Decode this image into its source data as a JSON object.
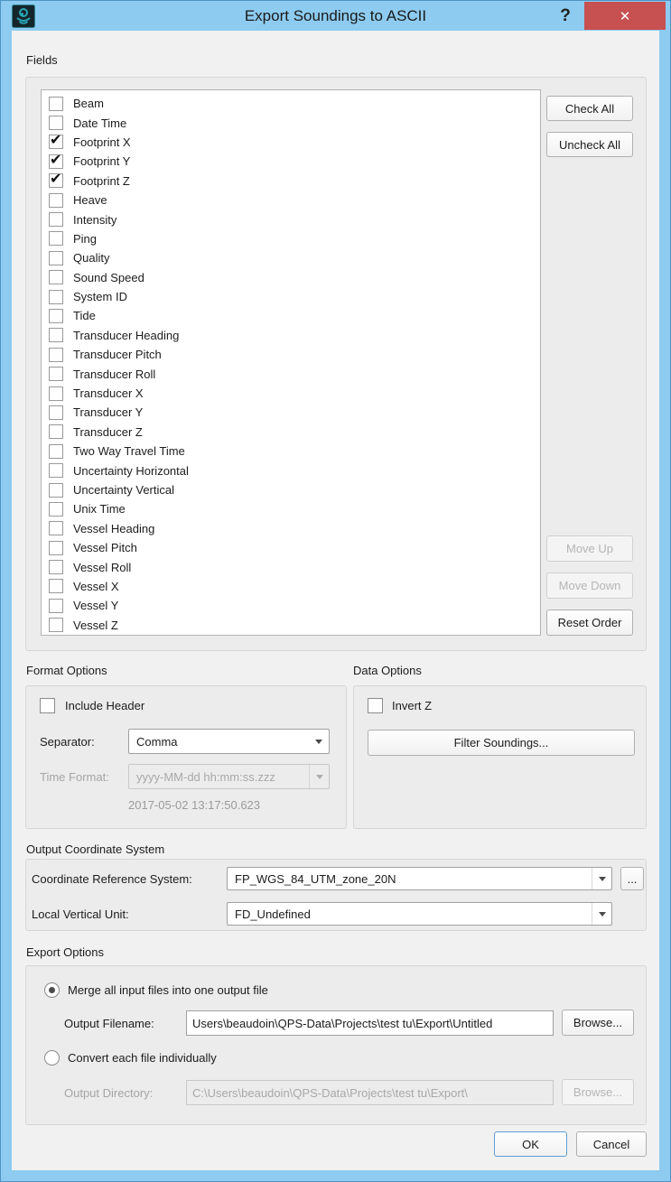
{
  "window": {
    "title": "Export Soundings to ASCII",
    "help_icon": "?",
    "close_icon": "✕"
  },
  "colors": {
    "titlebar": "#8dcbf0",
    "close_button": "#c75050",
    "dialog_bg": "#f1f1f1",
    "groupbox_bg": "#ececec",
    "default_button_border": "#5e9ed9"
  },
  "fields": {
    "section_label": "Fields",
    "check_glyph": "✔",
    "items": [
      {
        "label": "Beam",
        "checked": false
      },
      {
        "label": "Date Time",
        "checked": false
      },
      {
        "label": "Footprint X",
        "checked": true
      },
      {
        "label": "Footprint Y",
        "checked": true
      },
      {
        "label": "Footprint Z",
        "checked": true
      },
      {
        "label": "Heave",
        "checked": false
      },
      {
        "label": "Intensity",
        "checked": false
      },
      {
        "label": "Ping",
        "checked": false
      },
      {
        "label": "Quality",
        "checked": false
      },
      {
        "label": "Sound Speed",
        "checked": false
      },
      {
        "label": "System ID",
        "checked": false
      },
      {
        "label": "Tide",
        "checked": false
      },
      {
        "label": "Transducer Heading",
        "checked": false
      },
      {
        "label": "Transducer Pitch",
        "checked": false
      },
      {
        "label": "Transducer Roll",
        "checked": false
      },
      {
        "label": "Transducer X",
        "checked": false
      },
      {
        "label": "Transducer Y",
        "checked": false
      },
      {
        "label": "Transducer Z",
        "checked": false
      },
      {
        "label": "Two Way Travel Time",
        "checked": false
      },
      {
        "label": "Uncertainty Horizontal",
        "checked": false
      },
      {
        "label": "Uncertainty Vertical",
        "checked": false
      },
      {
        "label": "Unix Time",
        "checked": false
      },
      {
        "label": "Vessel Heading",
        "checked": false
      },
      {
        "label": "Vessel Pitch",
        "checked": false
      },
      {
        "label": "Vessel Roll",
        "checked": false
      },
      {
        "label": "Vessel X",
        "checked": false
      },
      {
        "label": "Vessel Y",
        "checked": false
      },
      {
        "label": "Vessel Z",
        "checked": false
      }
    ],
    "buttons": {
      "check_all": "Check All",
      "uncheck_all": "Uncheck All",
      "move_up": "Move Up",
      "move_down": "Move Down",
      "reset_order": "Reset Order"
    }
  },
  "format_options": {
    "section_label": "Format Options",
    "include_header_label": "Include Header",
    "include_header_checked": false,
    "separator_label": "Separator:",
    "separator_value": "Comma",
    "time_format_label": "Time Format:",
    "time_format_value": "yyyy-MM-dd hh:mm:ss.zzz",
    "time_format_enabled": false,
    "time_preview": "2017-05-02 13:17:50.623"
  },
  "data_options": {
    "section_label": "Data Options",
    "invert_z_label": "Invert Z",
    "invert_z_checked": false,
    "filter_soundings_label": "Filter Soundings..."
  },
  "output_coordinate_system": {
    "section_label": "Output Coordinate System",
    "crs_label": "Coordinate Reference System:",
    "crs_value": "FP_WGS_84_UTM_zone_20N",
    "crs_more_label": "...",
    "vertical_unit_label": "Local Vertical Unit:",
    "vertical_unit_value": "FD_Undefined"
  },
  "export_options": {
    "section_label": "Export Options",
    "merge_radio_label": "Merge all input files into one output file",
    "merge_selected": true,
    "output_filename_label": "Output Filename:",
    "output_filename_value": "Users\\beaudoin\\QPS-Data\\Projects\\test tu\\Export\\Untitled",
    "browse_merge_label": "Browse...",
    "convert_radio_label": "Convert each file individually",
    "convert_selected": false,
    "output_directory_label": "Output Directory:",
    "output_directory_value": "C:\\Users\\beaudoin\\QPS-Data\\Projects\\test tu\\Export\\",
    "browse_convert_label": "Browse..."
  },
  "footer": {
    "ok_label": "OK",
    "cancel_label": "Cancel"
  }
}
